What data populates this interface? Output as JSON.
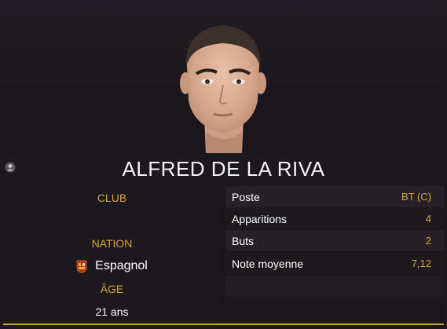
{
  "player": {
    "name": "ALFRED DE LA RIVA"
  },
  "info": {
    "club_label": "CLUB",
    "club_value": "",
    "nation_label": "NATION",
    "nation_value": "Espagnol",
    "age_label": "ÂGE",
    "age_value": "21 ans"
  },
  "stats": [
    {
      "label": "Poste",
      "value": "BT (C)"
    },
    {
      "label": "Apparitions",
      "value": "4"
    },
    {
      "label": "Buts",
      "value": "2"
    },
    {
      "label": "Note moyenne",
      "value": "7,12"
    }
  ],
  "colors": {
    "accent": "#d9a437",
    "background": "#1c181e",
    "row_dark": "#262126",
    "row_light": "#1d191d"
  },
  "icons": {
    "user": "person-icon",
    "flag": "spain-crest-icon"
  }
}
